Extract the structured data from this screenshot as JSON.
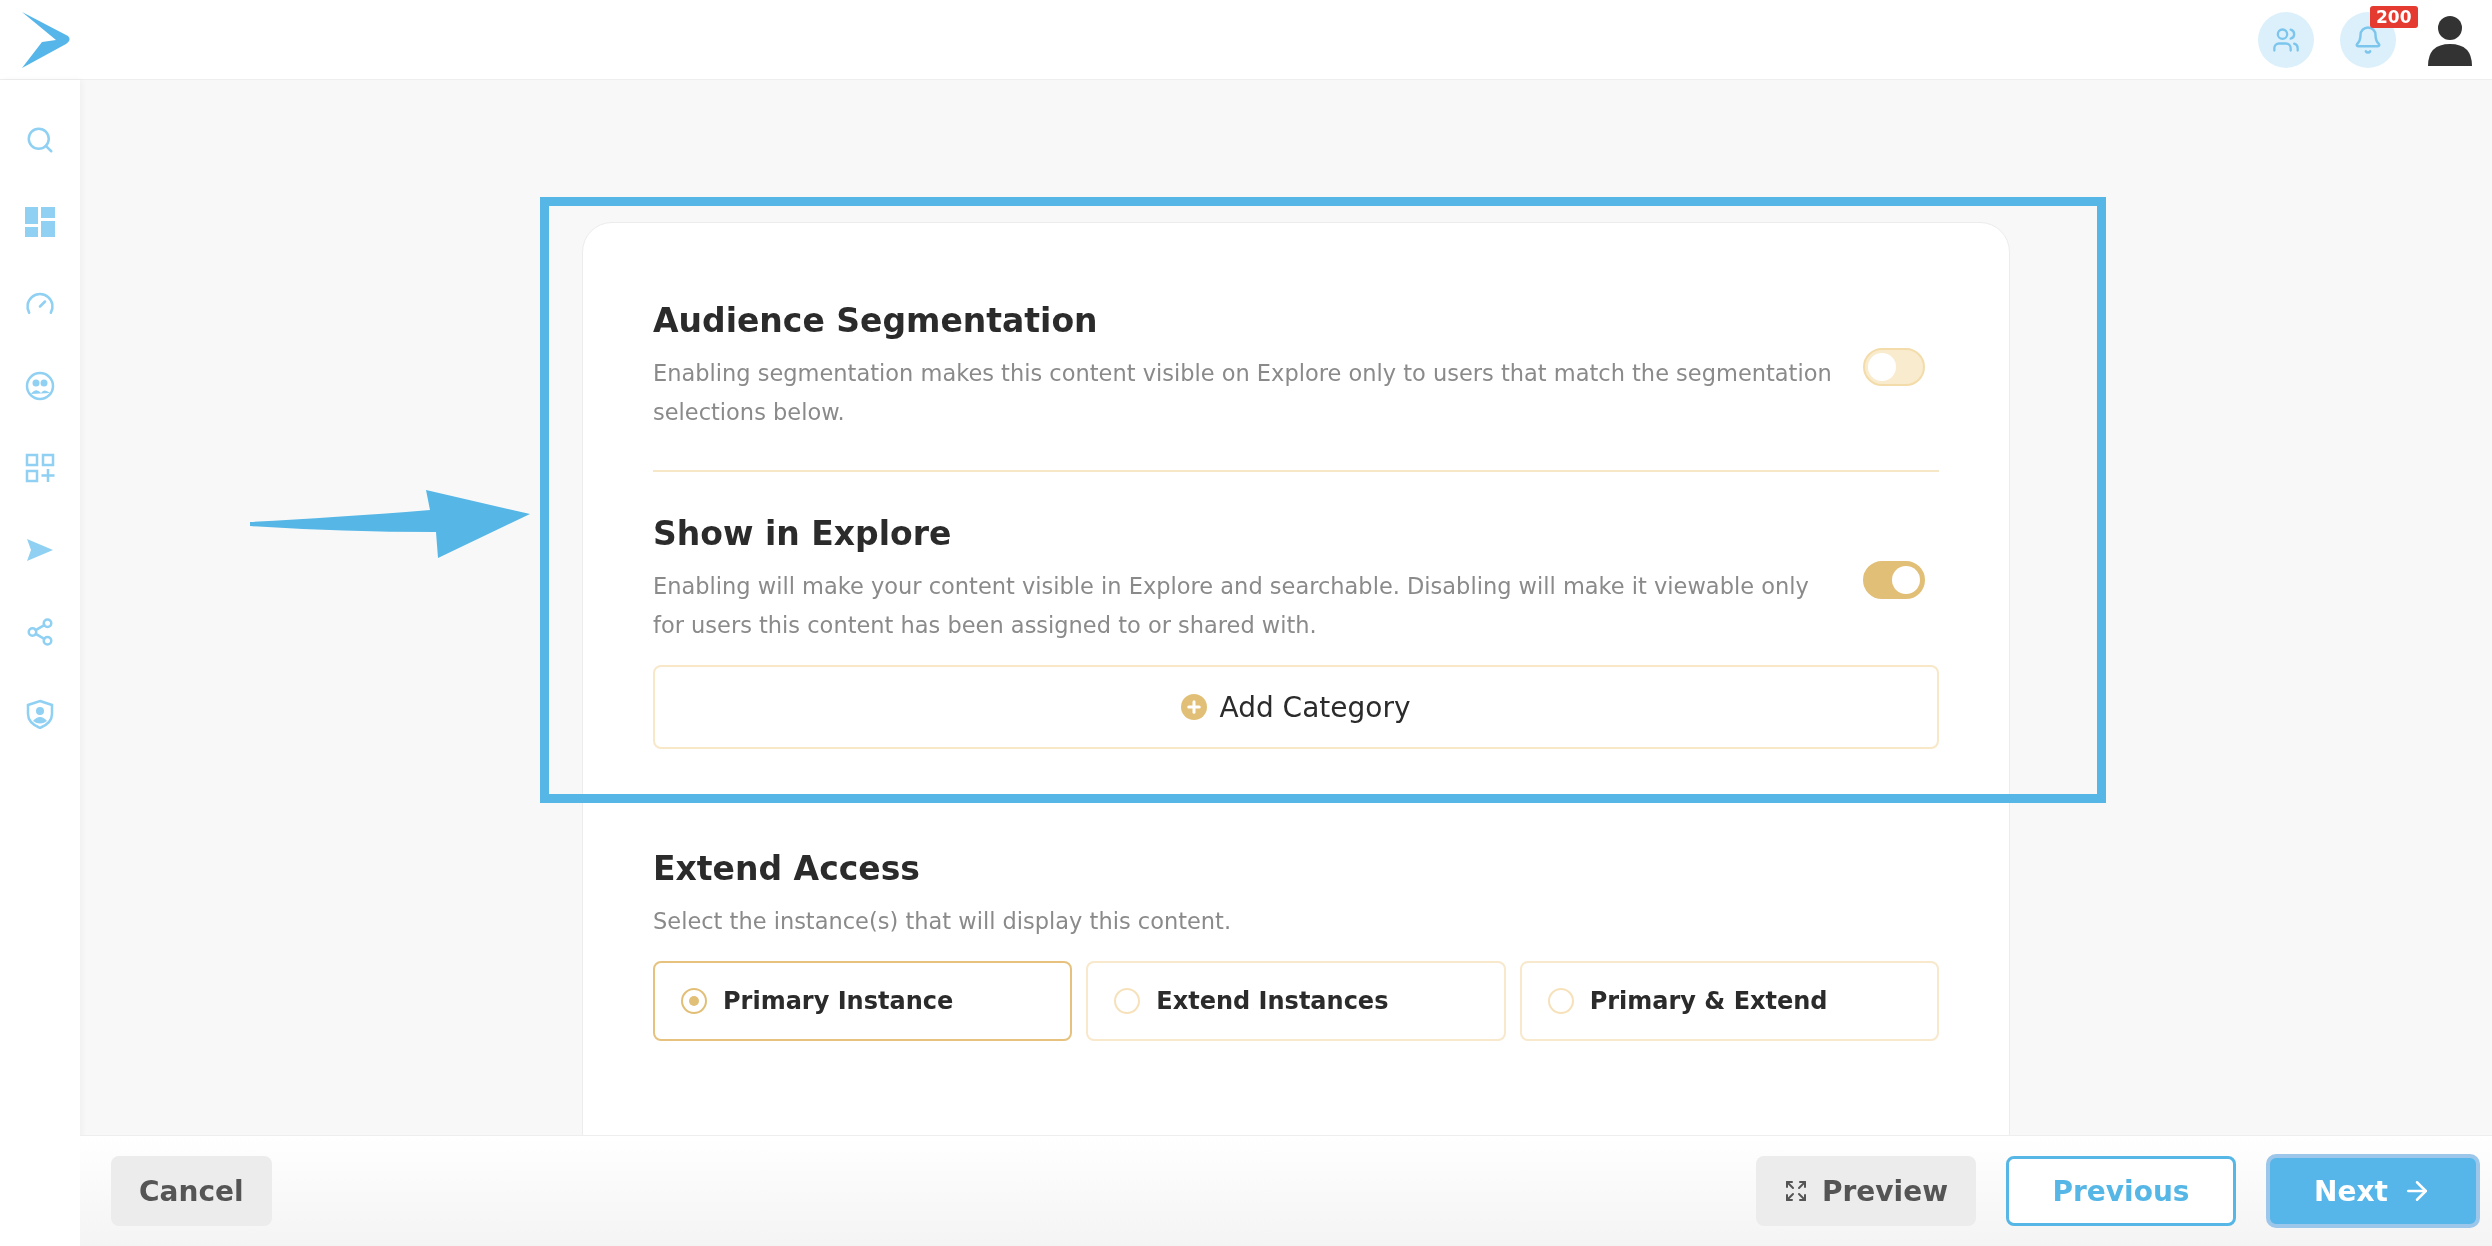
{
  "header": {
    "notification_badge": "200"
  },
  "sections": [
    {
      "kind": "toggle",
      "title": "Audience Segmentation",
      "description": "Enabling segmentation makes this content visible on Explore only to users that match the segmentation selections below.",
      "on": false
    },
    {
      "kind": "toggle",
      "title": "Show in Explore",
      "description": "Enabling will make your content visible in Explore and searchable. Disabling will make it viewable only for users this content has been assigned to or shared with.",
      "on": true,
      "action": "Add Category"
    }
  ],
  "extend_access": {
    "title": "Extend Access",
    "description": "Select the instance(s) that will display this content.",
    "options": [
      {
        "label": "Primary Instance",
        "selected": true
      },
      {
        "label": "Extend Instances",
        "selected": false
      },
      {
        "label": "Primary & Extend",
        "selected": false
      }
    ]
  },
  "footer": {
    "cancel": "Cancel",
    "preview": "Preview",
    "previous": "Previous",
    "next": "Next"
  }
}
